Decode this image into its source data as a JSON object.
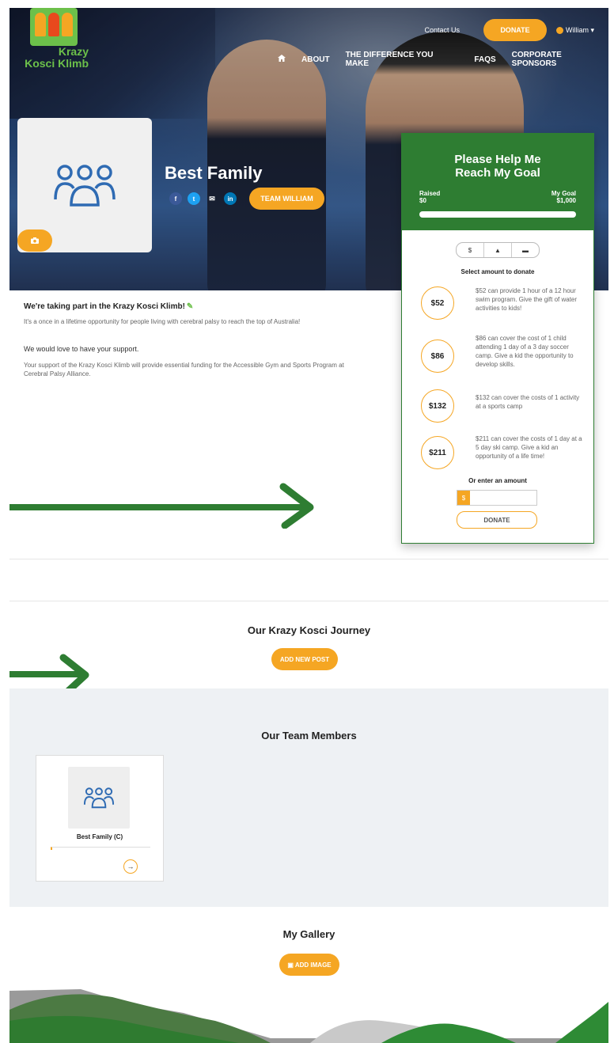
{
  "header": {
    "logo_text_line1": "Krazy",
    "logo_text_line2": "Kosci Klimb",
    "contact_label": "Contact Us",
    "donate_label": "DONATE",
    "user_label": "William ▾"
  },
  "nav": {
    "home_icon": "home-icon",
    "items": [
      {
        "label": "ABOUT"
      },
      {
        "label": "THE DIFFERENCE YOU MAKE"
      },
      {
        "label": "FAQS"
      },
      {
        "label": "CORPORATE SPONSORS"
      }
    ]
  },
  "profile": {
    "team_name": "Best Family",
    "team_button": "TEAM WILLIAM",
    "socials": [
      "f",
      "t",
      "✉",
      "in"
    ]
  },
  "widget": {
    "title_line1": "Please Help Me",
    "title_line2": "Reach My Goal",
    "raised_label": "Raised",
    "raised_value": "$0",
    "goal_label": "My Goal",
    "goal_value": "$1,000",
    "progress": 0,
    "toggle": [
      "$",
      "▲",
      "▬"
    ],
    "select_label": "Select amount to donate",
    "amounts": [
      {
        "value": "$52",
        "desc": "$52 can provide 1 hour of a 12 hour swim program. Give the gift of water activities to kids!"
      },
      {
        "value": "$86",
        "desc": "$86 can cover the cost of 1 child attending 1 day of a 3 day soccer camp. Give a kid the opportunity to develop skills."
      },
      {
        "value": "$132",
        "desc": "$132 can cover the costs of 1 activity at a sports camp"
      },
      {
        "value": "$211",
        "desc": "$211 can cover the costs of 1 day at a 5 day ski camp. Give a kid an opportunity of a life time!"
      }
    ],
    "enter_label": "Or enter an amount",
    "currency_symbol": "$",
    "donate_label": "DONATE"
  },
  "about": {
    "heading": "We're taking part in the Krazy Kosci Klimb!",
    "line1": "It's a once in a lifetime opportunity for people living with cerebral palsy to reach the top of Australia!",
    "subheading": "We would love to have your support.",
    "line2a": "Your support of the Krazy Kosci Klimb will provide essential funding for the Accessible Gym and Sports Program at",
    "line2b": "Cerebral Palsy Alliance."
  },
  "journey": {
    "heading": "Our Krazy Kosci Journey",
    "button": "ADD NEW POST"
  },
  "members": {
    "heading": "Our Team Members",
    "list": [
      {
        "name": "Best Family (C)"
      }
    ]
  },
  "gallery": {
    "heading": "My Gallery",
    "button": "▣ ADD IMAGE"
  },
  "colors": {
    "brand_green": "#2e7d32",
    "accent_orange": "#f5a623",
    "logo_green": "#6cc04a",
    "icon_blue": "#2f6bb3"
  }
}
